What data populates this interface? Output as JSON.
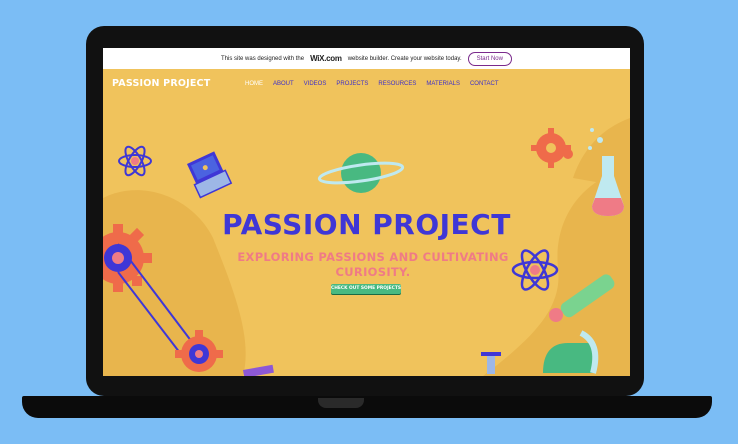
{
  "wix_banner": {
    "text_before": "This site was designed with the",
    "brand": "WiX.com",
    "text_after": "website builder. Create your website today.",
    "button_label": "Start Now"
  },
  "header": {
    "logo": "PASSION PROJECT",
    "nav": [
      "HOME",
      "ABOUT",
      "VIDEOS",
      "PROJECTS",
      "RESOURCES",
      "MATERIALS",
      "CONTACT"
    ],
    "active_nav": "HOME"
  },
  "hero": {
    "title": "PASSION PROJECT",
    "subtitle": "EXPLORING PASSIONS AND CULTIVATING CURIOSITY.",
    "cta_label": "CHECK OUT SOME PROJECTS"
  },
  "colors": {
    "background": "#7bbdf5",
    "hero_bg": "#f0c35c",
    "title": "#3f37d6",
    "subtitle": "#ef7b86",
    "cta": "#48b981",
    "nav": "#3d2fc9"
  },
  "decorations": [
    "atom-icon",
    "laptop-icon",
    "planet-icon",
    "gear-icon",
    "flask-icon",
    "microscope-icon",
    "pulley-icon"
  ]
}
